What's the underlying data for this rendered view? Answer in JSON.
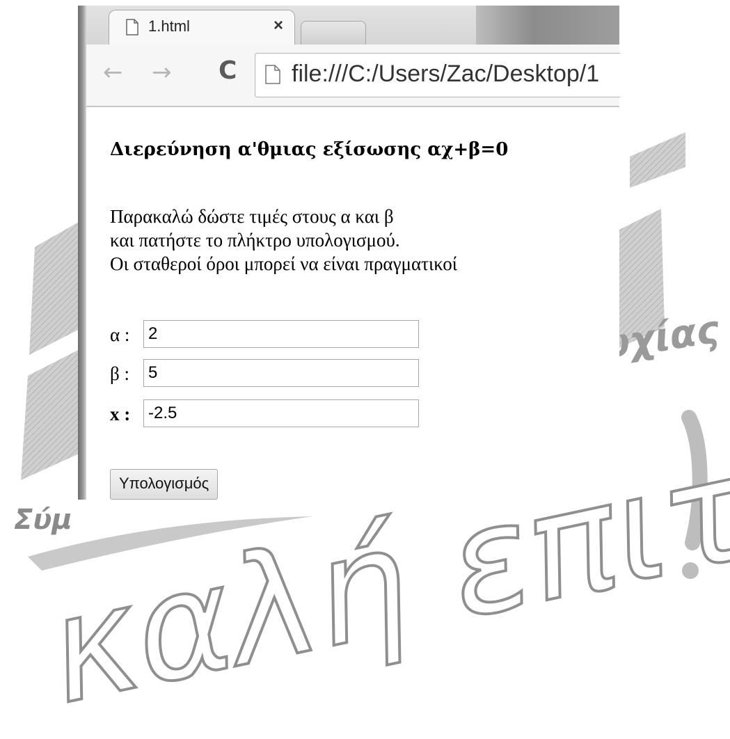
{
  "browser": {
    "tab_title": "1.html",
    "tab_close": "×",
    "back": "←",
    "forward": "→",
    "reload": "C",
    "url": "file:///C:/Users/Zac/Desktop/1"
  },
  "page": {
    "heading": "Διερεύνηση α'θμιας εξίσωσης αχ+β=0",
    "instructions": [
      "Παρακαλώ δώστε τιμές στους α και β",
      "και πατήστε το πλήκτρο υπολογισμού.",
      "Οι σταθεροί όροι μπορεί να είναι πραγματικοί"
    ],
    "fields": [
      {
        "label": "α :",
        "value": "2"
      },
      {
        "label": "β :",
        "value": "5"
      },
      {
        "label": "x :",
        "value": "-2.5"
      }
    ],
    "button_label": "Υπολογισμός"
  },
  "watermark": {
    "script_text": "καλή επιτυχία!",
    "partial_text_right": "υχίας",
    "partial_text_left": "Σύμ"
  },
  "colors": {
    "watermark_gray": "#bdbdbd",
    "watermark_dark": "#8a8a8a"
  }
}
